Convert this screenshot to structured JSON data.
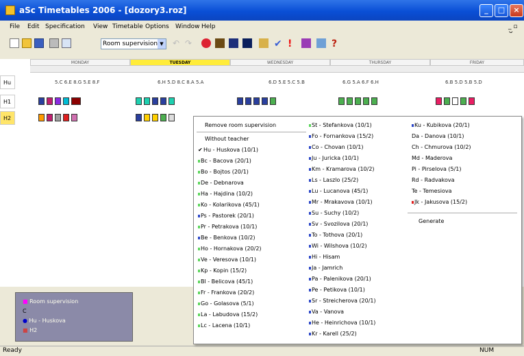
{
  "window": {
    "title": "aSc Timetables 2006  - [dozory3.roz]"
  },
  "menu": [
    "File",
    "Edit",
    "Specification",
    "View",
    "Timetable",
    "Options",
    "Window",
    "Help"
  ],
  "toolbar": {
    "select_value": "Room supervision"
  },
  "days": [
    "MONDAY",
    "TUESDAY",
    "WEDNESDAY",
    "THURSDAY",
    "FRIDAY"
  ],
  "row_labels": [
    "Hu",
    "H1",
    "H2"
  ],
  "cell_notes": [
    "5.C  6.E  8.G  5.E  8.F",
    "6.H  5.D  8.C  8.A  5.A",
    "6.D  5.E  5.C  5.B",
    "6.G      5.A  6.F      6.H",
    "6.B  5.D  5.B       5.D"
  ],
  "context_menu": {
    "col1": [
      {
        "text": "Remove room supervision",
        "mark": ""
      },
      {
        "text": "Without teacher",
        "mark": ""
      },
      {
        "text": "Hu - Huskova (10/1)",
        "mark": "check"
      },
      {
        "text": "Bc - Bacova (20/1)",
        "mark": "#5ad65a"
      },
      {
        "text": "Bo - Bojtos (20/1)",
        "mark": "#5ad65a"
      },
      {
        "text": "De - Debnarova",
        "mark": "#5ad65a"
      },
      {
        "text": "Ha - Hajdina (10/2)",
        "mark": "#5ad65a"
      },
      {
        "text": "Ko - Kolarikova (45/1)",
        "mark": "#5ad65a"
      },
      {
        "text": "Ps - Pastorek (20/1)",
        "mark": "#2a45c8"
      },
      {
        "text": "Pr - Petrakova (10/1)",
        "mark": "#5ad65a"
      },
      {
        "text": "Be - Benkova (10/2)",
        "mark": "#2a45c8"
      },
      {
        "text": "Ho - Hornakova (20/2)",
        "mark": "#5ad65a"
      },
      {
        "text": "Ve - Veresova (10/1)",
        "mark": "#5ad65a"
      },
      {
        "text": "Kp - Kopin (15/2)",
        "mark": "#5ad65a"
      },
      {
        "text": "Bl - Belicova (45/1)",
        "mark": "#5ad65a"
      },
      {
        "text": "Fr - Frankova (20/2)",
        "mark": "#5ad65a"
      },
      {
        "text": "Go - Golasova (5/1)",
        "mark": "#5ad65a"
      },
      {
        "text": "La - Labudova (15/2)",
        "mark": "#5ad65a"
      },
      {
        "text": "Lc - Lacena (10/1)",
        "mark": "#5ad65a"
      }
    ],
    "col2": [
      {
        "text": "St - Stefankova (10/1)",
        "mark": "#5ad65a"
      },
      {
        "text": "Fo - Fornankova (15/2)",
        "mark": "#2a45c8"
      },
      {
        "text": "Co - Chovan (10/1)",
        "mark": "#2a45c8"
      },
      {
        "text": "Ju - Juricka (10/1)",
        "mark": "#2a45c8"
      },
      {
        "text": "Km - Kramarova (10/2)",
        "mark": "#2a45c8"
      },
      {
        "text": "Ls - Laszlo (25/2)",
        "mark": "#2a45c8"
      },
      {
        "text": "Lu - Lucanova (45/1)",
        "mark": "#2a45c8"
      },
      {
        "text": "Mr - Mrakavova (10/1)",
        "mark": "#2a45c8"
      },
      {
        "text": "Su - Suchy (10/2)",
        "mark": "#2a45c8"
      },
      {
        "text": "Sv - Svozilova (20/1)",
        "mark": "#2a45c8"
      },
      {
        "text": "To - Tothova (20/1)",
        "mark": "#2a45c8"
      },
      {
        "text": "Wi - Wilshova (10/2)",
        "mark": "#2a45c8"
      },
      {
        "text": "Hi - Hisam",
        "mark": "#2a45c8"
      },
      {
        "text": "Ja - Jamrich",
        "mark": "#2a45c8"
      },
      {
        "text": "Pa - Palenikova (20/1)",
        "mark": "#2a45c8"
      },
      {
        "text": "Pe - Petikova (10/1)",
        "mark": "#2a45c8"
      },
      {
        "text": "Sr - Streicherova (20/1)",
        "mark": "#2a45c8"
      },
      {
        "text": "Va - Vanova",
        "mark": "#2a45c8"
      },
      {
        "text": "He - Heinrichova (10/1)",
        "mark": "#2a45c8"
      },
      {
        "text": "Kr - Karell (25/2)",
        "mark": "#2a45c8"
      }
    ],
    "col3": [
      {
        "text": "Ku - Kubikova (20/1)",
        "mark": "#2a45c8"
      },
      {
        "text": "Da - Danova (10/1)",
        "mark": ""
      },
      {
        "text": "Ch - Chmurova (10/2)",
        "mark": ""
      },
      {
        "text": "Md - Maderova",
        "mark": ""
      },
      {
        "text": "Pi - Pirselova (5/1)",
        "mark": ""
      },
      {
        "text": "Rd - Radvakova",
        "mark": ""
      },
      {
        "text": "Te - Temesiova",
        "mark": ""
      },
      {
        "text": "Jk - Jakusova (15/2)",
        "mark": "#e02020"
      },
      {
        "text": "Generate",
        "mark": ""
      }
    ]
  },
  "legend": [
    "Room supervision",
    "C",
    "Hu - Huskova",
    "H2"
  ],
  "status": {
    "left": "Ready",
    "right": "NUM"
  },
  "colors": {
    "title_blue": "#0a4fd6",
    "highlight": "#ffec3a",
    "lesson_colors": [
      "#2a3f9e",
      "#c02070",
      "#8a2be2",
      "#00bcd4",
      "#8b0000",
      "#1ed0b0",
      "#ff9a00",
      "#4caf50",
      "#e91e63",
      "#9e9e9e"
    ]
  }
}
